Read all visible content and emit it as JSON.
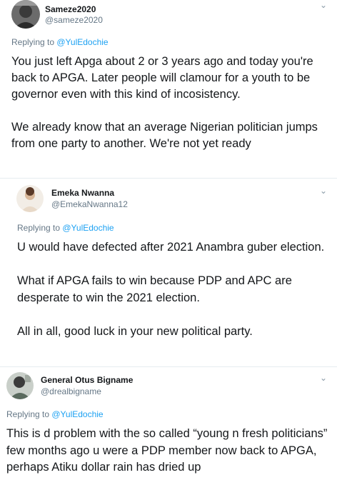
{
  "tweets": [
    {
      "name": "Sameze2020",
      "handle": "@sameze2020",
      "replying_prefix": "Replying to ",
      "replying_to": "@YulEdochie",
      "text": "You just left Apga about 2 or 3 years ago and today you're back to APGA. Later people will clamour for a youth to be governor even with this kind of incosistency.\n\nWe already know that an average Nigerian politician jumps from one party to another. We're not yet ready"
    },
    {
      "name": "Emeka Nwanna",
      "handle": "@EmekaNwanna12",
      "replying_prefix": "Replying to ",
      "replying_to": "@YulEdochie",
      "text": "U would have defected after 2021 Anambra guber election.\n\nWhat if APGA fails to win because PDP and APC are desperate to win the 2021 election.\n\nAll in all, good luck in your new political party."
    },
    {
      "name": "General Otus Bigname",
      "handle": "@drealbigname",
      "replying_prefix": "Replying to ",
      "replying_to": "@YulEdochie",
      "text": "This is d problem with the so called “young n fresh politicians” few months ago u were a PDP member now back to APGA, perhaps Atiku dollar rain has dried up"
    }
  ],
  "icons": {
    "more": "chevron-down-icon"
  },
  "colors": {
    "link": "#1da1f2",
    "muted": "#657786",
    "text": "#14171a"
  }
}
